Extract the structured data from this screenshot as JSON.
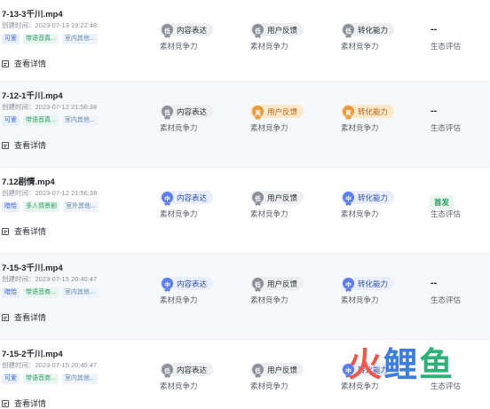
{
  "rows": [
    {
      "file_name": "7-13-3千川.mp4",
      "created": "创建时间：2023-07-13 19:22:48",
      "tags": [
        "可爱",
        "带语音真...",
        "室内其他..."
      ],
      "detail": "查看详情",
      "metrics": [
        {
          "level": "低",
          "label": "内容表达",
          "sub": "素材竞争力"
        },
        {
          "level": "低",
          "label": "用户反馈",
          "sub": "素材竞争力"
        },
        {
          "level": "低",
          "label": "转化能力",
          "sub": "素材竞争力"
        }
      ],
      "eco": {
        "value": "--",
        "sub": "生态评估"
      }
    },
    {
      "file_name": "7-12-1千川.mp4",
      "created": "创建时间：2023-07-12 21:56:38",
      "tags": [
        "可爱",
        "带语音真...",
        "室内其他..."
      ],
      "detail": "查看详情",
      "metrics": [
        {
          "level": "低",
          "label": "内容表达",
          "sub": "素材竞争力"
        },
        {
          "level": "高",
          "label": "用户反馈",
          "sub": "素材竞争力"
        },
        {
          "level": "高",
          "label": "转化能力",
          "sub": "素材竞争力"
        }
      ],
      "eco": {
        "value": "--",
        "sub": "生态评估"
      }
    },
    {
      "file_name": "7.12剧情.mp4",
      "created": "创建时间：2023-07-12 21:56:38",
      "tags": [
        "暗恰",
        "多人情景剧",
        "室外其他..."
      ],
      "detail": "查看详情",
      "metrics": [
        {
          "level": "中",
          "label": "内容表达",
          "sub": "素材竞争力"
        },
        {
          "level": "低",
          "label": "用户反馈",
          "sub": "素材竞争力"
        },
        {
          "level": "中",
          "label": "转化能力",
          "sub": "素材竞争力"
        }
      ],
      "eco": {
        "value": "首发",
        "sub": "生态评估"
      }
    },
    {
      "file_name": "7-15-3千川.mp4",
      "created": "创建时间：2023-07-15 20:40:47",
      "tags": [
        "暗恰",
        "带语音商...",
        "室内其他..."
      ],
      "detail": "查看详情",
      "metrics": [
        {
          "level": "中",
          "label": "内容表达",
          "sub": "素材竞争力"
        },
        {
          "level": "低",
          "label": "用户反馈",
          "sub": "素材竞争力"
        },
        {
          "level": "中",
          "label": "转化能力",
          "sub": "素材竞争力"
        }
      ],
      "eco": {
        "value": "--",
        "sub": "生态评估"
      }
    },
    {
      "file_name": "7-15-2千川.mp4",
      "created": "创建时间：2023-07-15 20:40:47",
      "tags": [
        "可爱",
        "带语音商...",
        "室内其他..."
      ],
      "detail": "查看详情",
      "metrics": [
        {
          "level": "低",
          "label": "内容表达",
          "sub": "素材竞争力"
        },
        {
          "level": "低",
          "label": "用户反馈",
          "sub": "素材竞争力"
        },
        {
          "level": "中",
          "label": "转化能力",
          "sub": "素材竞争力"
        }
      ],
      "eco": {
        "value": "--",
        "sub": "生态评估"
      }
    }
  ],
  "watermark": {
    "chars": [
      "火",
      "鲤",
      "鱼"
    ],
    "colors": [
      "#f0584a",
      "#3c7de0",
      "#2fb27a"
    ]
  },
  "colors": {
    "low_badge": "#8c9098",
    "mid_badge": "#5b7cf2",
    "high_badge": "#e79a3c",
    "tag_blue": "#3d63d8",
    "tag_green": "#2f9d68",
    "first_release": "#1d9a5b"
  }
}
